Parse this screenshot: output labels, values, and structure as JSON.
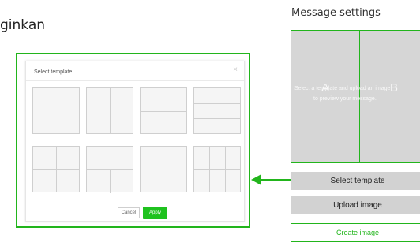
{
  "background_text": {
    "partial_word": "ginkan"
  },
  "modal": {
    "title": "Select template",
    "close_glyph": "×",
    "template_count": 8,
    "cancel_label": "Cancel",
    "apply_label": "Apply"
  },
  "settings": {
    "title": "Message settings",
    "preview": {
      "line1": "Select a template and upload an image",
      "line2": "to preview your message.",
      "area_a": "A",
      "area_b": "B"
    },
    "select_template_label": "Select template",
    "upload_image_label": "Upload image",
    "create_image_label": "Create image"
  },
  "colors": {
    "accent_green": "#22b51c",
    "apply_green": "#1fc21f",
    "button_gray": "#d2d2d2",
    "preview_gray": "#d6d6d6"
  },
  "icons": {
    "close": "close-icon",
    "arrow": "arrow-left-icon",
    "dot": "pointer-dot"
  }
}
